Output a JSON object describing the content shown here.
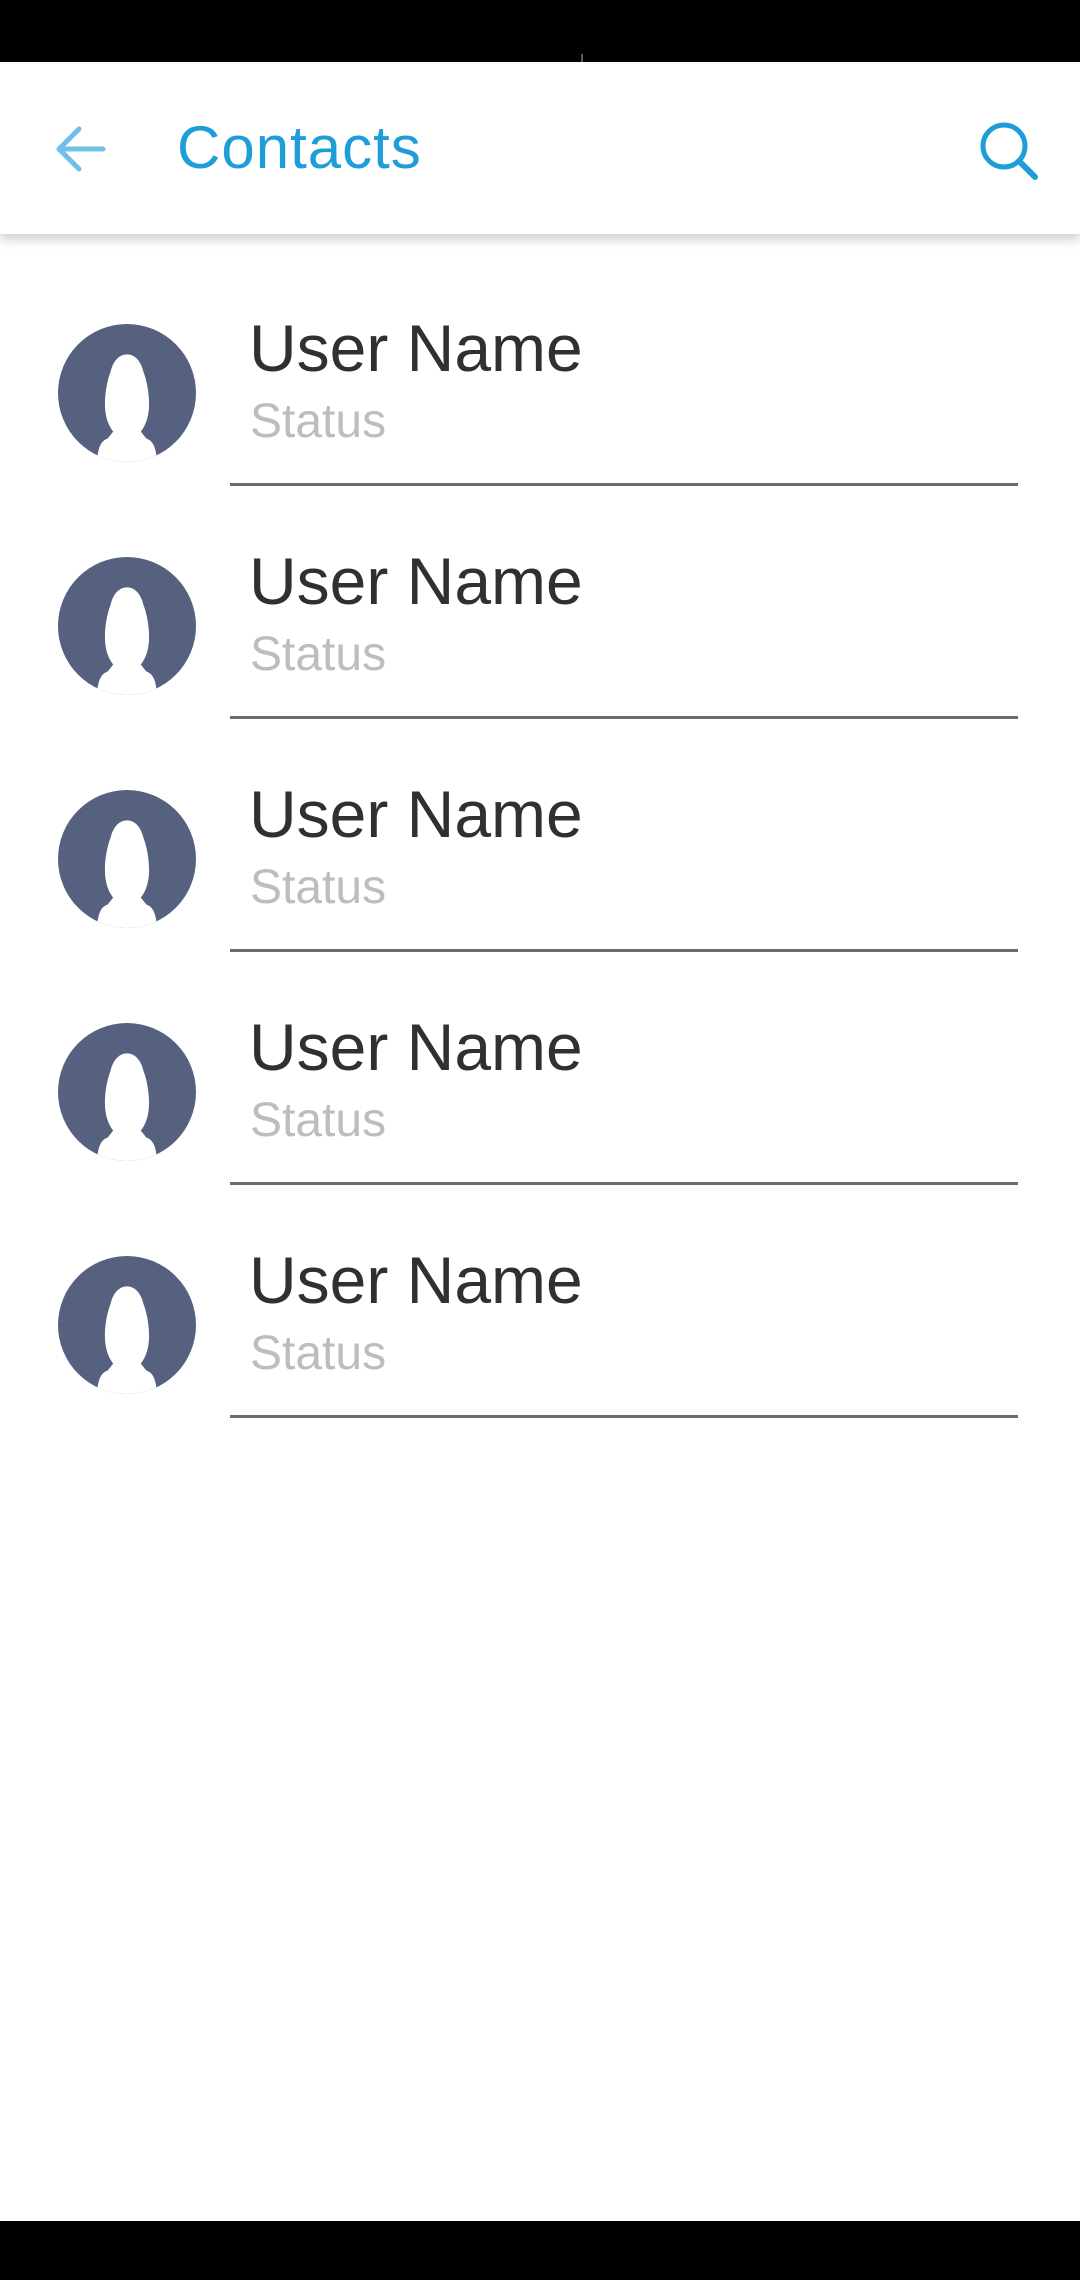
{
  "app_bar": {
    "title": "Contacts",
    "back_icon": "arrow-left-icon",
    "search_icon": "search-icon"
  },
  "colors": {
    "accent": "#1e9dd8",
    "back_arrow": "#6fc0e8",
    "avatar": "#55617f",
    "name_text": "#303030",
    "status_text": "#bdbdbd",
    "divider": "#6b6b6b"
  },
  "contacts": [
    {
      "name": "User Name",
      "status": "Status",
      "avatar_icon": "person-silhouette-icon"
    },
    {
      "name": "User Name",
      "status": "Status",
      "avatar_icon": "person-silhouette-icon"
    },
    {
      "name": "User Name",
      "status": "Status",
      "avatar_icon": "person-silhouette-icon"
    },
    {
      "name": "User Name",
      "status": "Status",
      "avatar_icon": "person-silhouette-icon"
    },
    {
      "name": "User Name",
      "status": "Status",
      "avatar_icon": "person-silhouette-icon"
    }
  ]
}
